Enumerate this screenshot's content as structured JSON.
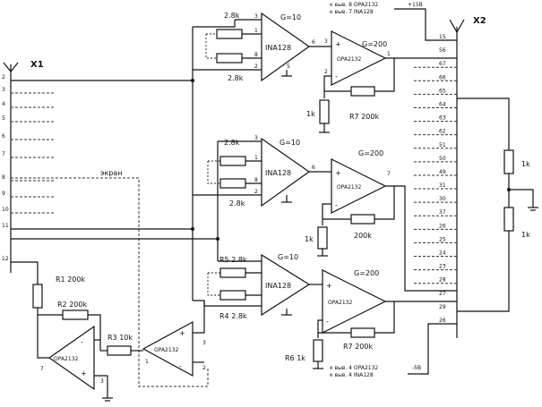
{
  "connectors": {
    "x1": "X1",
    "x2": "X2"
  },
  "x1_pins": [
    "2",
    "3",
    "4",
    "5",
    "6",
    "7",
    "8",
    "9",
    "10",
    "11",
    "12"
  ],
  "x2_pins": [
    "15",
    "56",
    "67",
    "66",
    "65",
    "64",
    "63",
    "62",
    "51",
    "50",
    "49",
    "31",
    "30",
    "37",
    "26",
    "25",
    "24",
    "23",
    "28",
    "27",
    "29",
    "26"
  ],
  "amps": {
    "ina1": "INA128",
    "ina1_gain": "G=10",
    "ina2": "INA128",
    "ina2_gain": "G=10",
    "ina3": "INA128",
    "ina3_gain": "G=10",
    "opa1": "OPA2132",
    "opa1_gain": "G=200",
    "opa2": "OPA2132",
    "opa2_gain": "G=200",
    "opa3": "OPA2132",
    "opa3_gain": "G=200",
    "opa4": "OPA2132",
    "opa5": "OPA2132"
  },
  "resistors": {
    "r_ina1_top": "2.8k",
    "r_ina1_bot": "2.8k",
    "r_ina2_top": "2.8k",
    "r_ina2_bot": "2.8k",
    "r_ina3_top": "R5 2.8k",
    "r_ina3_bot": "R4 2.8k",
    "r_opa1_g": "1k",
    "r_opa1_f": "R7 200k",
    "r_opa2_g": "1k",
    "r_opa2_f": "200k",
    "r_opa3_g": "R6 1k",
    "r_opa3_f": "R7 200k",
    "r1": "R1 200k",
    "r2": "R2 200k",
    "r3": "R3 10k",
    "r_div1": "1k",
    "r_div2": "1k"
  },
  "notes": {
    "top": "к выв. 8 OPA2132",
    "top2": "к выв. 7 INA128",
    "top_pin": "+15B",
    "bottom": "к выв. 4 OPA2132",
    "bottom2": "к выв. 4 INA128",
    "bottom_pin": "-5B",
    "shield": "экран"
  }
}
